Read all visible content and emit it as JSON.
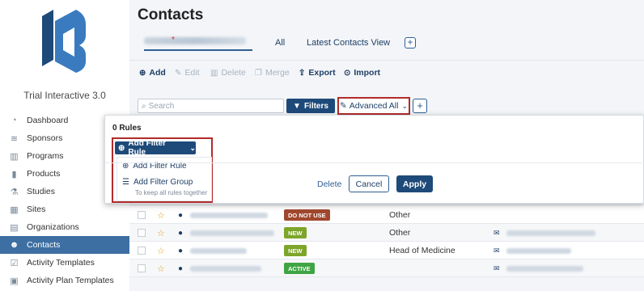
{
  "app": {
    "name": "Trial Interactive 3.0"
  },
  "sidebar": {
    "items": [
      {
        "label": "Dashboard",
        "icon": "dashboard-icon",
        "glyph": "◔"
      },
      {
        "label": "Sponsors",
        "icon": "database-icon",
        "glyph": "≋"
      },
      {
        "label": "Programs",
        "icon": "programs-icon",
        "glyph": "▥"
      },
      {
        "label": "Products",
        "icon": "barcode-icon",
        "glyph": "▮"
      },
      {
        "label": "Studies",
        "icon": "flask-icon",
        "glyph": "⚗"
      },
      {
        "label": "Sites",
        "icon": "building-icon",
        "glyph": "▦"
      },
      {
        "label": "Organizations",
        "icon": "organization-icon",
        "glyph": "▤"
      },
      {
        "label": "Contacts",
        "icon": "users-icon",
        "glyph": "☻",
        "active": true
      },
      {
        "label": "Activity Templates",
        "icon": "checklist-icon",
        "glyph": "☑"
      },
      {
        "label": "Activity Plan Templates",
        "icon": "calendar-icon",
        "glyph": "▣"
      }
    ]
  },
  "page": {
    "title": "Contacts"
  },
  "tabs": {
    "items": [
      "All",
      "Latest Contacts View"
    ],
    "add_label": "+"
  },
  "toolbar": {
    "add": "Add",
    "edit": "Edit",
    "delete": "Delete",
    "merge": "Merge",
    "export": "Export",
    "import": "Import"
  },
  "search": {
    "placeholder": "Search",
    "filters_label": "Filters",
    "advanced_label": "Advanced All",
    "add_label": "+"
  },
  "filter_panel": {
    "rules_count": "0 Rules",
    "add_rule_button": "Add Filter Rule",
    "menu": {
      "add_rule": "Add Filter Rule",
      "add_group": "Add Filter Group",
      "add_group_hint": "To keep all rules together"
    },
    "delete_label": "Delete",
    "cancel_label": "Cancel",
    "apply_label": "Apply"
  },
  "table": {
    "rows": [
      {
        "badge": "DO NOT USE",
        "badge_color": "#a0482e",
        "role": "Other",
        "has_email": false
      },
      {
        "badge": "NEW",
        "badge_color": "#7da52a",
        "role": "Other",
        "has_email": true
      },
      {
        "badge": "NEW",
        "badge_color": "#7da52a",
        "role": "Head of Medicine",
        "has_email": true
      },
      {
        "badge": "ACTIVE",
        "badge_color": "#3fa544",
        "role": "",
        "has_email": true
      }
    ]
  },
  "colors": {
    "primary": "#1e4a79",
    "active_nav": "#3d6fa3",
    "highlight_outline": "#b22b2b"
  }
}
